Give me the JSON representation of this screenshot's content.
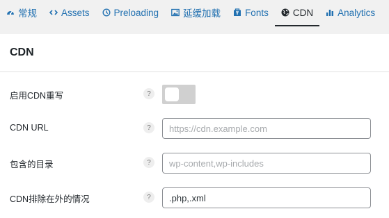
{
  "tabs": [
    {
      "label": "常规",
      "icon": "dashboard-icon"
    },
    {
      "label": "Assets",
      "icon": "code-icon"
    },
    {
      "label": "Preloading",
      "icon": "clock-icon"
    },
    {
      "label": "延缓加载",
      "icon": "image-icon"
    },
    {
      "label": "Fonts",
      "icon": "fonts-icon"
    },
    {
      "label": "CDN",
      "icon": "globe-icon",
      "active": true
    },
    {
      "label": "Analytics",
      "icon": "chart-icon"
    }
  ],
  "panel": {
    "title": "CDN",
    "rows": [
      {
        "label": "启用CDN重写",
        "help": "?",
        "type": "toggle",
        "enabled": false
      },
      {
        "label": "CDN URL",
        "help": "?",
        "type": "text",
        "value": "",
        "placeholder": "https://cdn.example.com"
      },
      {
        "label": "包含的目录",
        "help": "?",
        "type": "text",
        "value": "",
        "placeholder": "wp-content,wp-includes"
      },
      {
        "label": "CDN排除在外的情况",
        "help": "?",
        "type": "text",
        "value": ".php,.xml",
        "placeholder": ""
      }
    ]
  },
  "colors": {
    "accent": "#2271b1",
    "toggle_off": "#d0d0d0"
  }
}
